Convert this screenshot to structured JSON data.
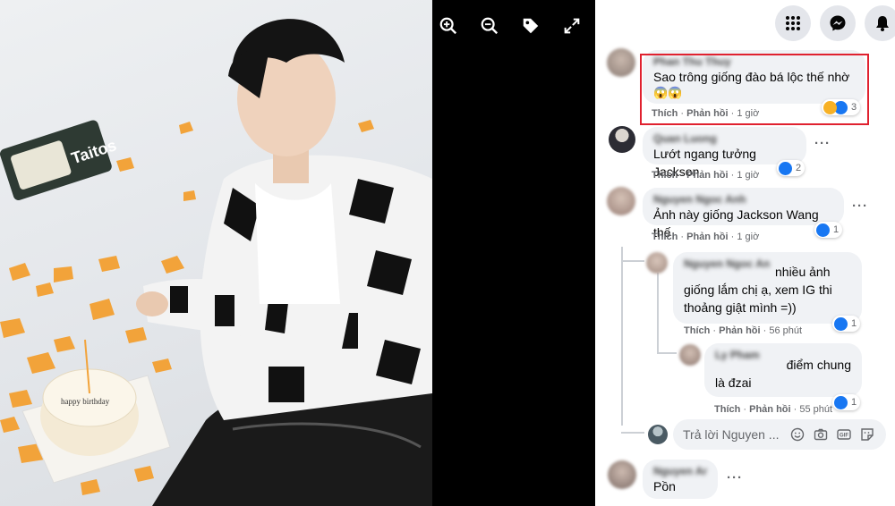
{
  "viewer": {
    "toolbar": [
      "zoom-in-icon",
      "zoom-out-icon",
      "tag-icon",
      "fullscreen-icon"
    ],
    "photo": {
      "bag_text": "Taitos",
      "cake_text": "happy birthday"
    }
  },
  "topbar": {
    "icons": [
      "menu-grid-icon",
      "messenger-icon",
      "bell-icon"
    ]
  },
  "comments": [
    {
      "author": "Phan Thu Thuy",
      "text": "Sao trông giống đào bá lộc thế nhờ",
      "emoji": "😱😱",
      "like": "Thích",
      "reply": "Phản hồi",
      "time": "1 giờ",
      "reactions": "3"
    },
    {
      "author": "Quan Luong",
      "text": "Lướt ngang tưởng Jackson",
      "like": "Thích",
      "reply": "Phản hồi",
      "time": "1 giờ",
      "reactions": "2"
    },
    {
      "author": "Nguyen Ngoc Anh",
      "text": "Ảnh này giống Jackson Wang thế",
      "like": "Thích",
      "reply": "Phản hồi",
      "time": "1 giờ",
      "reactions": "1"
    }
  ],
  "replies": [
    {
      "author": "Nguyen Ngoc Anh",
      "text_lead": "nhiều ảnh",
      "lines": [
        "giống lắm chị ạ, xem IG thi",
        "thoảng giật mình =))"
      ],
      "like": "Thích",
      "reply": "Phản hồi",
      "time": "56 phút",
      "reactions": "1"
    },
    {
      "author": "Ly Pham",
      "text_lead": "điểm chung",
      "lines": [
        "là đzai"
      ],
      "like": "Thích",
      "reply": "Phản hồi",
      "time": "55 phút",
      "reactions": "1"
    }
  ],
  "reply_input": {
    "placeholder": "Trả lời Nguyen ..."
  },
  "last_comment": {
    "author": "Nguyen Anh",
    "text": "Pồn"
  },
  "colors": {
    "highlight": "#e0212f",
    "like_blue": "#1877f2",
    "bubble_bg": "#f0f2f5"
  }
}
